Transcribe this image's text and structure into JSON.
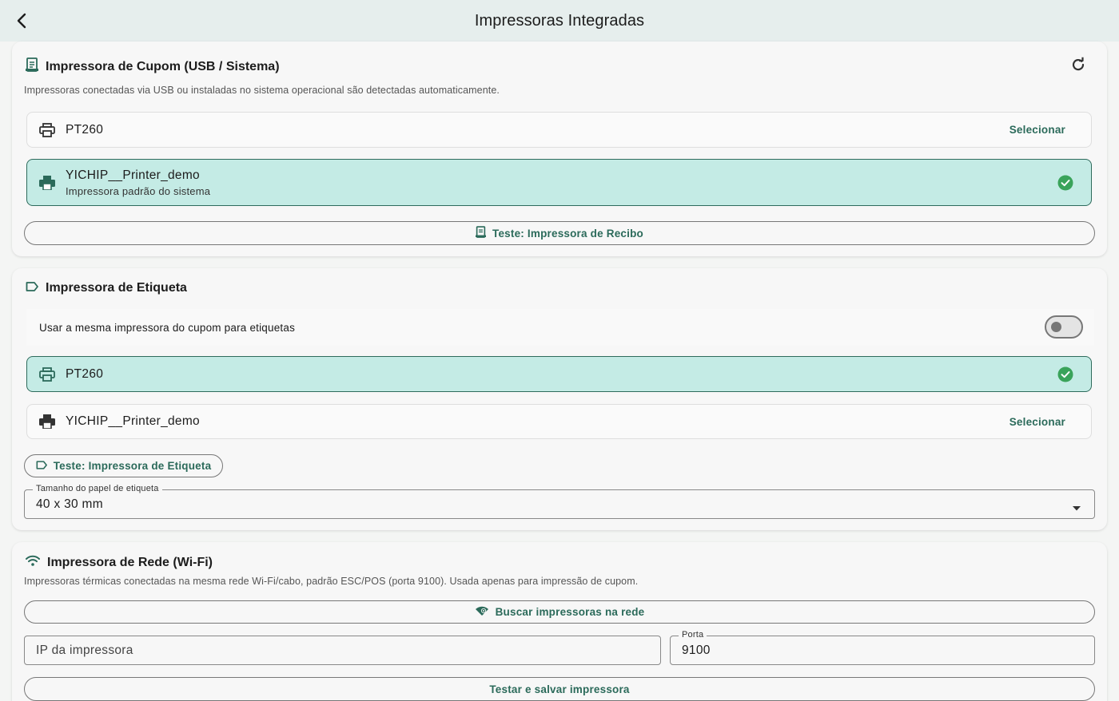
{
  "appbar": {
    "title": "Impressoras Integradas"
  },
  "receipt": {
    "title": "Impressora de Cupom (USB / Sistema)",
    "description": "Impressoras conectadas via USB ou instaladas no sistema operacional são detectadas automaticamente.",
    "printers": [
      {
        "name": "PT260",
        "action": "Selecionar",
        "selected": false
      },
      {
        "name": "YICHIP__Printer_demo",
        "subtitle": "Impressora padrão do sistema",
        "selected": true
      }
    ],
    "test_button": "Teste: Impressora de Recibo"
  },
  "label": {
    "title": "Impressora de Etiqueta",
    "same_printer_toggle": {
      "label": "Usar a mesma impressora do cupom para etiquetas",
      "on": false
    },
    "printers": [
      {
        "name": "PT260",
        "selected": true
      },
      {
        "name": "YICHIP__Printer_demo",
        "action": "Selecionar",
        "selected": false
      }
    ],
    "test_button": "Teste: Impressora de Etiqueta",
    "paper_size": {
      "label": "Tamanho do papel de etiqueta",
      "value": "40 x 30 mm"
    }
  },
  "network": {
    "title": "Impressora de Rede (Wi-Fi)",
    "description": "Impressoras térmicas conectadas na mesma rede Wi-Fi/cabo, padrão ESC/POS (porta 9100). Usada apenas para impressão de cupom.",
    "search_button": "Buscar impressoras na rede",
    "ip_field": {
      "placeholder": "IP da impressora",
      "value": ""
    },
    "port_field": {
      "label": "Porta",
      "value": "9100"
    },
    "save_button": "Testar e salvar impressora"
  },
  "colors": {
    "accent": "#2b6a5a",
    "selected_bg": "#c4ebe5",
    "check": "#3aa35a",
    "appbar": "#e6eeed"
  }
}
